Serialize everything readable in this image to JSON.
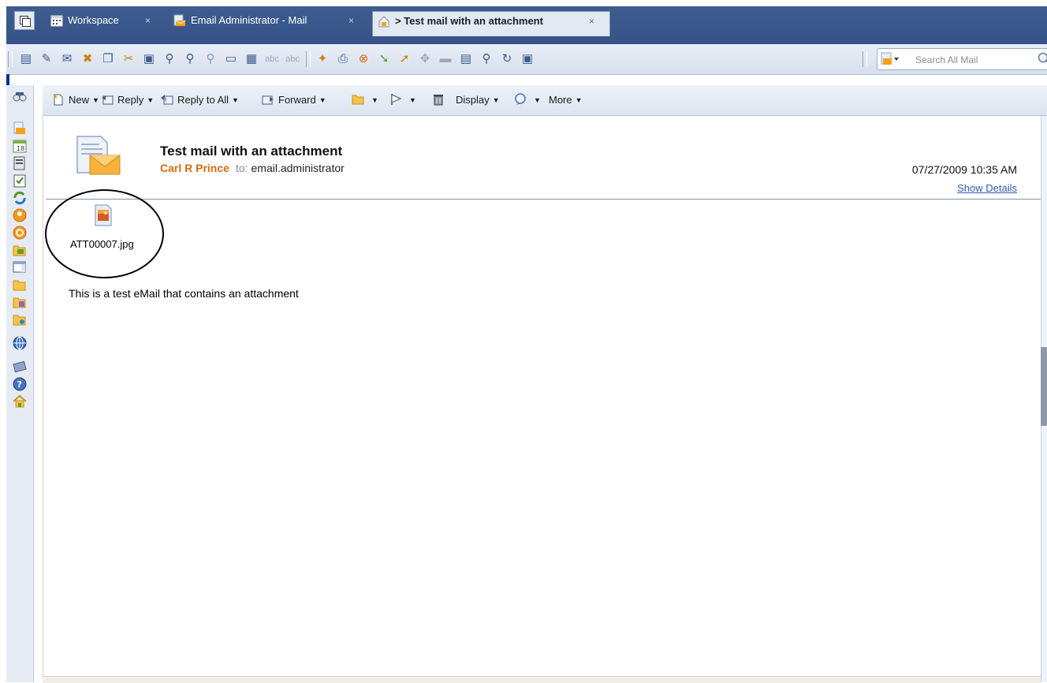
{
  "tabs": [
    {
      "label": "Workspace",
      "icon": "calendar-grid-icon",
      "close": "×"
    },
    {
      "label": "Email Administrator - Mail",
      "icon": "mail-icon",
      "close": "×"
    },
    {
      "label": "> Test mail with an attachment",
      "icon": "home-mail-icon",
      "close": "×",
      "active": true
    }
  ],
  "search": {
    "placeholder": "Search All Mail"
  },
  "actions": {
    "new": "New",
    "reply": "Reply",
    "reply_all": "Reply to All",
    "forward": "Forward",
    "display": "Display",
    "more": "More"
  },
  "message": {
    "subject": "Test mail with an attachment",
    "sender": "Carl R Prince",
    "to_label": "to:",
    "recipient": "email.administrator",
    "datetime": "07/27/2009 10:35 AM",
    "show_details": "Show Details",
    "attachment": "ATT00007.jpg",
    "body": "This is a test eMail that contains an attachment"
  },
  "colors": {
    "tabbar": "#355388",
    "sender": "#d86a12",
    "link": "#2a5db0",
    "accent_border": "#0b2f8a"
  }
}
